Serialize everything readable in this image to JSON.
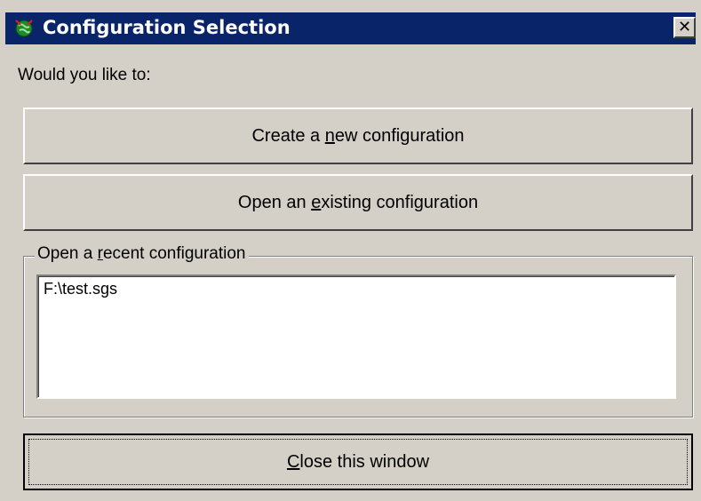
{
  "window": {
    "title": "Configuration Selection",
    "close_glyph": "✕",
    "app_icon": "green-globe-icon"
  },
  "prompt": "Would you like to:",
  "buttons": {
    "create": {
      "pre": "Create a ",
      "mnemonic": "n",
      "post": "ew configuration"
    },
    "open": {
      "pre": "Open an ",
      "mnemonic": "e",
      "post": "xisting configuration"
    },
    "close": {
      "pre": "",
      "mnemonic": "C",
      "post": "lose this window"
    }
  },
  "recent": {
    "label_pre": "Open a ",
    "label_mnemonic": "r",
    "label_post": "ecent configuration",
    "items": [
      "F:\\test.sgs"
    ]
  },
  "colors": {
    "titlebar": "#0a246a",
    "face": "#d4d0c8"
  }
}
